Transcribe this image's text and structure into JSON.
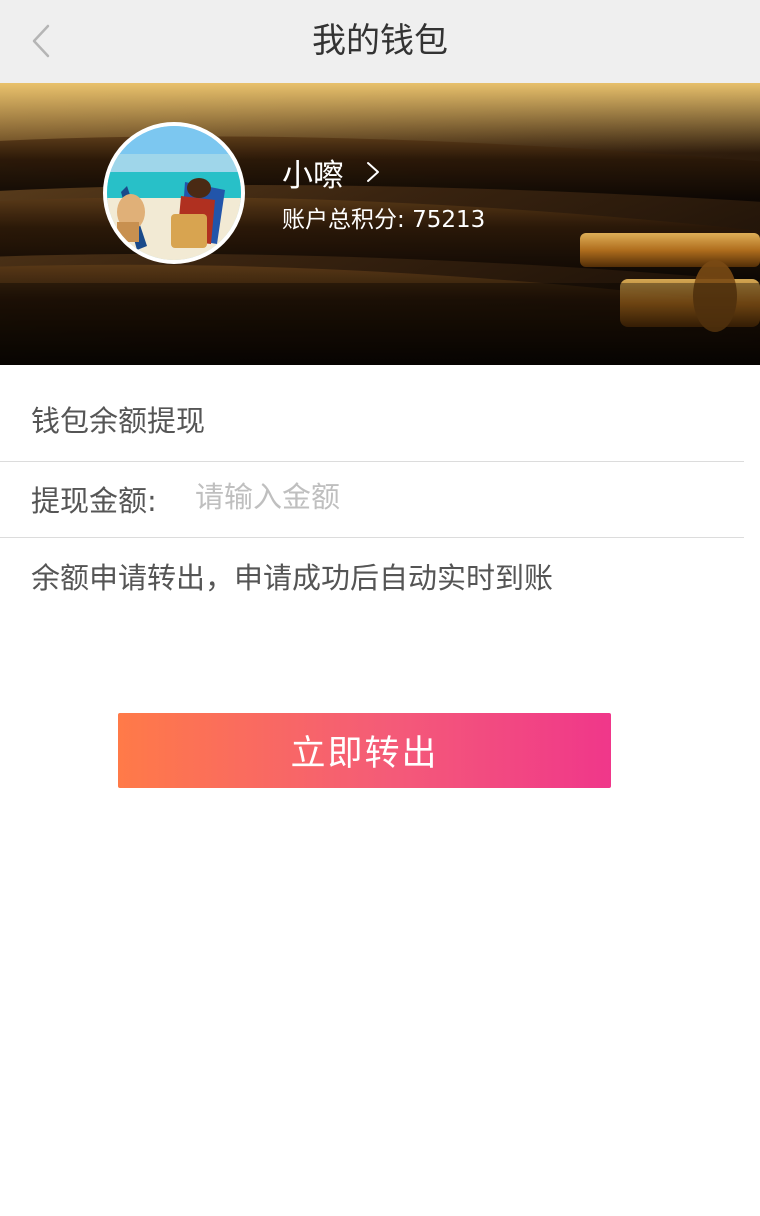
{
  "header": {
    "title": "我的钱包",
    "back_icon": "chevron-left-icon"
  },
  "profile": {
    "username": "小嚓",
    "points_label": "账户总积分:",
    "points_value": "75213",
    "avatar_description_icon": "avatar-image"
  },
  "withdraw": {
    "section_title": "钱包余额提现",
    "amount_label": "提现金额:",
    "amount_value": "",
    "amount_placeholder": "请输入金额",
    "note": "余额申请转出，申请成功后自动实时到账"
  },
  "actions": {
    "submit_label": "立即转出"
  },
  "colors": {
    "nav_bg": "#efefef",
    "button_gradient_start": "#ff7a48",
    "button_gradient_end": "#f0378a",
    "text_primary": "#555555",
    "placeholder": "#bfbfbf"
  }
}
